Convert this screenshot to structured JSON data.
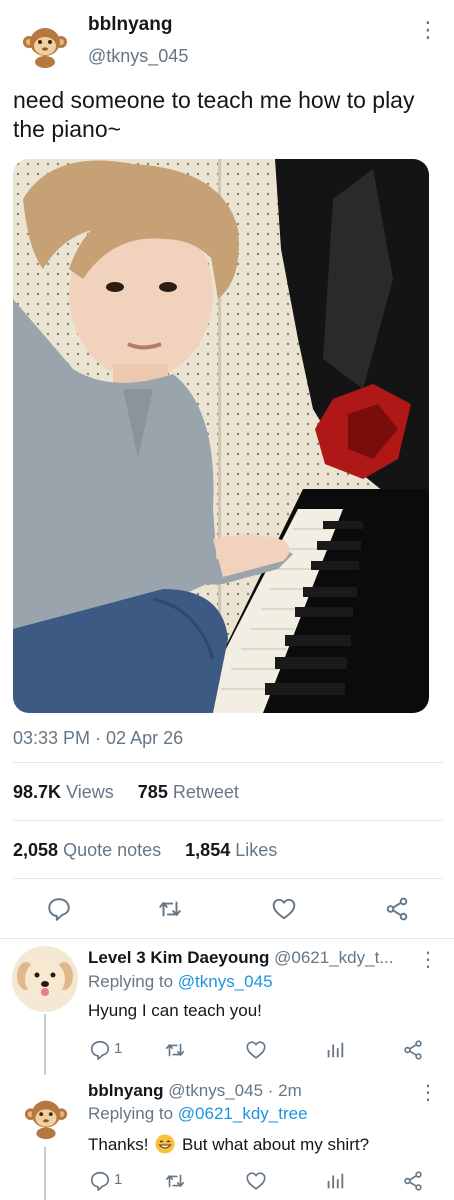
{
  "post": {
    "author_name": "bblnyang",
    "author_handle": "@tknys_045",
    "text": "need someone to teach me how to play the piano~",
    "timestamp": "03:33 PM · 02 Apr 26",
    "views_count": "98.7K",
    "views_label": "Views",
    "retweet_count": "785",
    "retweet_label": "Retweet",
    "quote_count": "2,058",
    "quote_label": "Quote notes",
    "likes_count": "1,854",
    "likes_label": "Likes"
  },
  "replies": [
    {
      "name": "Level 3 Kim Daeyoung",
      "handle": "@0621_kdy_t...",
      "replying_prefix": "Replying to",
      "replying_to": "@tknys_045",
      "text": "Hyung I can teach you!",
      "reply_count": "1"
    },
    {
      "name": "bblnyang",
      "handle": "@tknys_045",
      "time": "· 2m",
      "replying_prefix": "Replying to",
      "replying_to": "@0621_kdy_tree",
      "text_before": "Thanks!",
      "text_after": "But what about my shirt?",
      "reply_count": "1"
    }
  ],
  "colors": {
    "text": "#14171a",
    "secondary": "#657786",
    "link": "#1b95e0",
    "divider": "#e1e8ed"
  }
}
